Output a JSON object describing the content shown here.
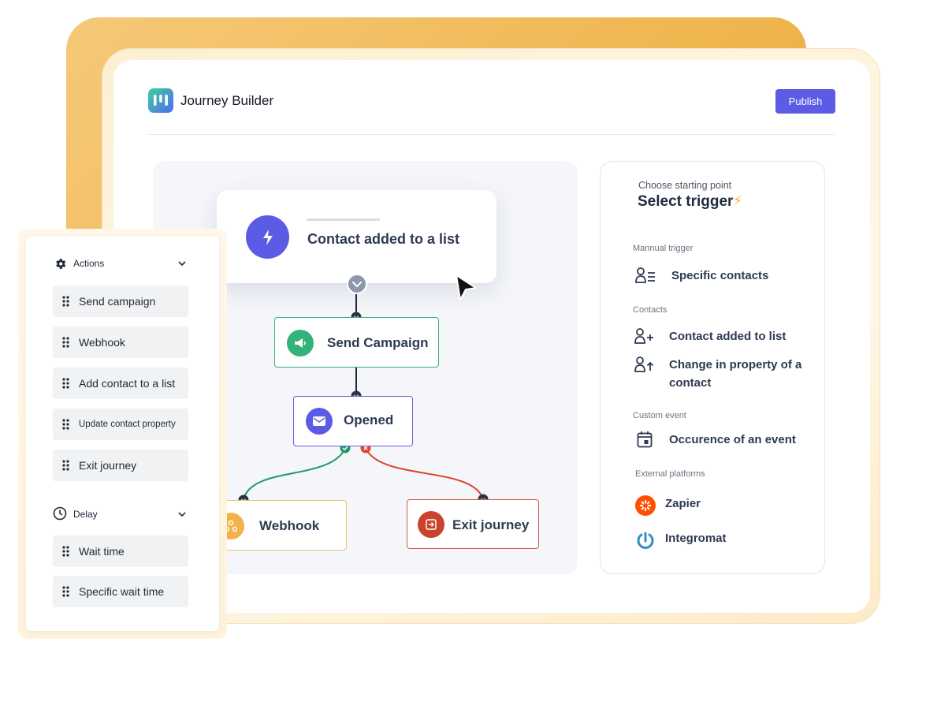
{
  "header": {
    "app_title": "Journey Builder",
    "publish_label": "Publish"
  },
  "trigger_card": {
    "label": "Contact added to a list"
  },
  "nodes": {
    "send_campaign": "Send Campaign",
    "opened": "Opened",
    "webhook": "Webhook",
    "exit_journey": "Exit journey"
  },
  "trigger_panel": {
    "subtitle": "Choose starting point",
    "title": "Select trigger",
    "sections": [
      {
        "label": "Mannual trigger",
        "items": [
          "Specific contacts"
        ]
      },
      {
        "label": "Contacts",
        "items": [
          "Contact added to list",
          "Change in property of a contact"
        ]
      },
      {
        "label": "Custom event",
        "items": [
          "Occurence of an event"
        ]
      },
      {
        "label": "External platforms",
        "items": [
          "Zapier",
          "Integromat"
        ]
      }
    ]
  },
  "actions_panel": {
    "actions_header": "Actions",
    "actions": [
      "Send campaign",
      "Webhook",
      "Add contact to a list",
      "Update contact property",
      "Exit journey"
    ],
    "delay_header": "Delay",
    "delay": [
      "Wait time",
      "Specific wait time"
    ]
  },
  "colors": {
    "accent": "#5b5be6",
    "success": "#33b27a",
    "danger": "#d9533c",
    "warning": "#f1b24a"
  }
}
